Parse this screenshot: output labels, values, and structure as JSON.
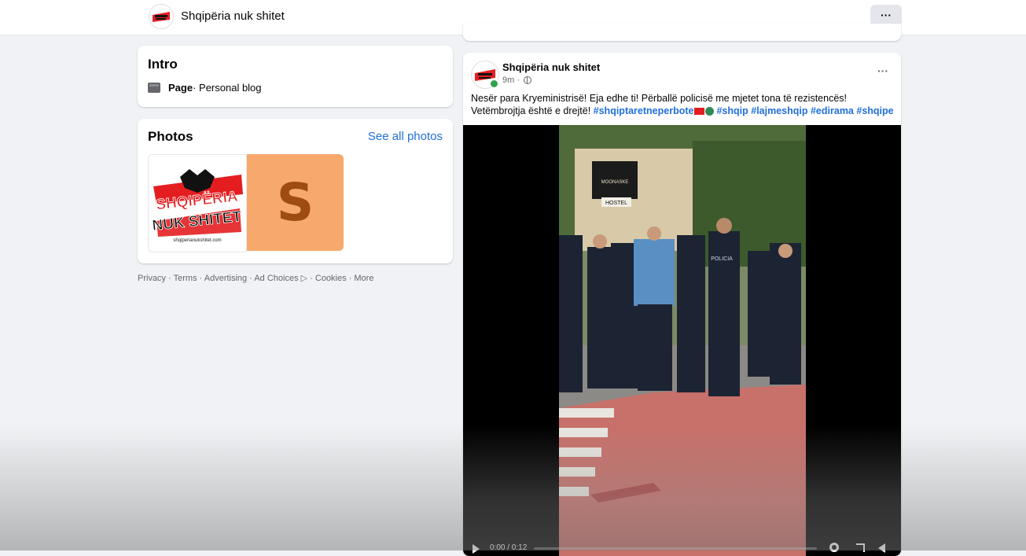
{
  "header": {
    "page_name": "Shqipëria nuk shitet",
    "more_label": "···"
  },
  "intro": {
    "title": "Intro",
    "type_label": "Page",
    "category": " · Personal blog"
  },
  "photos": {
    "title": "Photos",
    "see_all": "See all photos",
    "logo_text_line1": "SHQIPËRIA",
    "logo_text_line2": "NUK SHITET",
    "logo_url_text": "shqiperianukshitet.com",
    "second_photo_letter": "S"
  },
  "footer": {
    "links": "Privacy · Terms · Advertising · Ad Choices ▷ · Cookies · More"
  },
  "post": {
    "author": "Shqipëria nuk shitet",
    "time": "9m ·",
    "more_label": "···",
    "text": "Nesër para Kryeministrisë! Eja edhe ti! Përballë policisë me mjetet tona të rezistencës! Vetëmbrojtja është e drejtë! ",
    "hashtags": [
      "#shqiptaretneperbote",
      "#shqip",
      "#lajmeshqip",
      "#edirama",
      "#shqipe"
    ],
    "video": {
      "time": "0:00 / 0:12",
      "progress": 0.0,
      "sign_top": "MOONASKE",
      "sign_bottom": "HOSTEL",
      "jacket_text": "POLICIA"
    }
  },
  "colors": {
    "accent": "#216fdb",
    "background": "#f0f2f5",
    "online": "#31a24c"
  }
}
